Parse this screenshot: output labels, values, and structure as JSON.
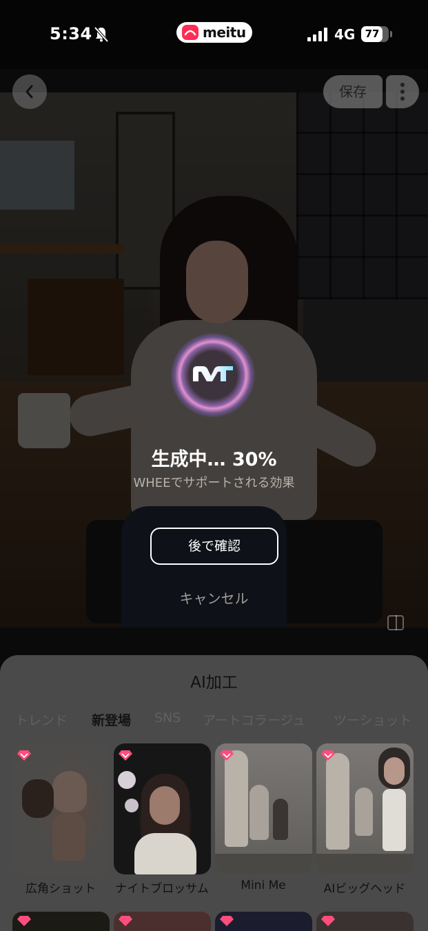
{
  "status_bar": {
    "time": "5:34",
    "brand": "meitu",
    "network": "4G",
    "battery": "77",
    "battery_level": 0.77
  },
  "header": {
    "save_label": "保存"
  },
  "progress": {
    "label": "生成中… 30%",
    "percent": 30,
    "powered_by": "WHEEでサポートされる効果",
    "later_label": "後で確認",
    "cancel_label": "キャンセル"
  },
  "sheet": {
    "title": "AI加工",
    "tabs": [
      {
        "label": "トレンド",
        "active": false
      },
      {
        "label": "新登場",
        "active": true
      },
      {
        "label": "SNS",
        "active": false
      },
      {
        "label": "アートコラージュ",
        "active": false
      },
      {
        "label": "ツーショット",
        "active": false
      }
    ],
    "effects": [
      {
        "label": "広角ショット",
        "vip": true
      },
      {
        "label": "ナイトブロッサム",
        "vip": true
      },
      {
        "label": "Mini Me",
        "vip": true
      },
      {
        "label": "AIビッグヘッド",
        "vip": true
      }
    ]
  },
  "colors": {
    "accent": "#ff2d55",
    "ring_glow": "#d88cff",
    "vip_badge": "#ff4d7d"
  }
}
